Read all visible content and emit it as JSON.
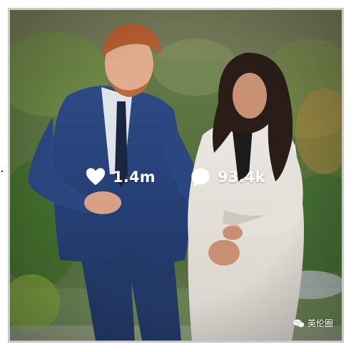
{
  "post": {
    "likes_count": "1.4m",
    "comments_count": "93.4k"
  },
  "watermark": {
    "text": "英伦圈"
  },
  "icons": {
    "likes": "heart-icon",
    "comments": "speech-bubble-icon",
    "watermark": "wechat-icon"
  },
  "colors": {
    "overlay_text": "#ffffff",
    "frame": "#c9c9c9"
  }
}
